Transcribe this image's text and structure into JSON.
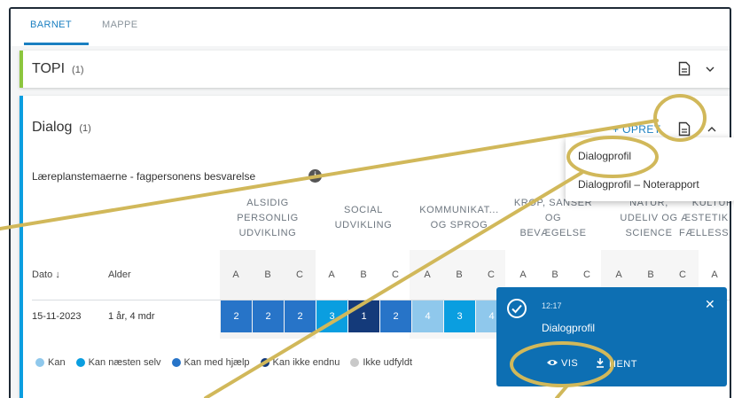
{
  "tabs": [
    {
      "label": "BARNET",
      "active": true
    },
    {
      "label": "MAPPE",
      "active": false
    }
  ],
  "topi_card": {
    "title": "TOPI",
    "count": "(1)"
  },
  "dialog_card": {
    "title": "Dialog",
    "count": "(1)",
    "create_label": "+ OPRET",
    "subtitle": "Læreplanstemaerne - fagpersonens besvarelse",
    "info_icon": "i"
  },
  "table": {
    "groups": [
      "ALSIDIG\nPERSONLIG\nUDVIKLING",
      "SOCIAL\nUDVIKLING",
      "KOMMUNIKAT...\nOG SPROG",
      "KROP, SANSER\nOG\nBEVÆGELSE",
      "NATUR,\nUDELIV OG\nSCIENCE",
      "KULTUR,\nÆSTETIK OG\nFÆLLESSKAB"
    ],
    "date_header": "Dato",
    "sort_icon": "↓",
    "age_header": "Alder",
    "sub_cols": [
      "A",
      "B",
      "C",
      "A",
      "B",
      "C",
      "A",
      "B",
      "C",
      "A",
      "B",
      "C",
      "A",
      "B",
      "C",
      "A"
    ],
    "row": {
      "date": "15-11-2023",
      "age": "1 år, 4 mdr",
      "values": [
        "2",
        "2",
        "2",
        "3",
        "1",
        "2",
        "4",
        "3",
        "4"
      ]
    }
  },
  "legend": [
    {
      "label": "Kan",
      "color": "#8fc8ec"
    },
    {
      "label": "Kan næsten selv",
      "color": "#0a9ee0"
    },
    {
      "label": "Kan med hjælp",
      "color": "#2774c8"
    },
    {
      "label": "Kan ikke endnu",
      "color": "#143a7a"
    },
    {
      "label": "Ikke udfyldt",
      "color": "#c9c9c9"
    }
  ],
  "menu": {
    "items": [
      "Dialogprofil",
      "Dialogprofil – Noterapport"
    ]
  },
  "toast": {
    "time": "12:17",
    "title": "Dialogprofil",
    "view_label": "VIS",
    "download_label": "HENT",
    "close_icon": "✕"
  },
  "colors": {
    "accent": "#1a7fc1",
    "topi_border": "#8cc63e",
    "dialog_border": "#0a9ee0",
    "toast_bg": "#0d6fb3",
    "highlight": "#d1b85a",
    "level_kan": "#8fc8ec",
    "level_naesten": "#0a9ee0",
    "level_hjaelp": "#2774c8",
    "level_ikke": "#143a7a"
  }
}
